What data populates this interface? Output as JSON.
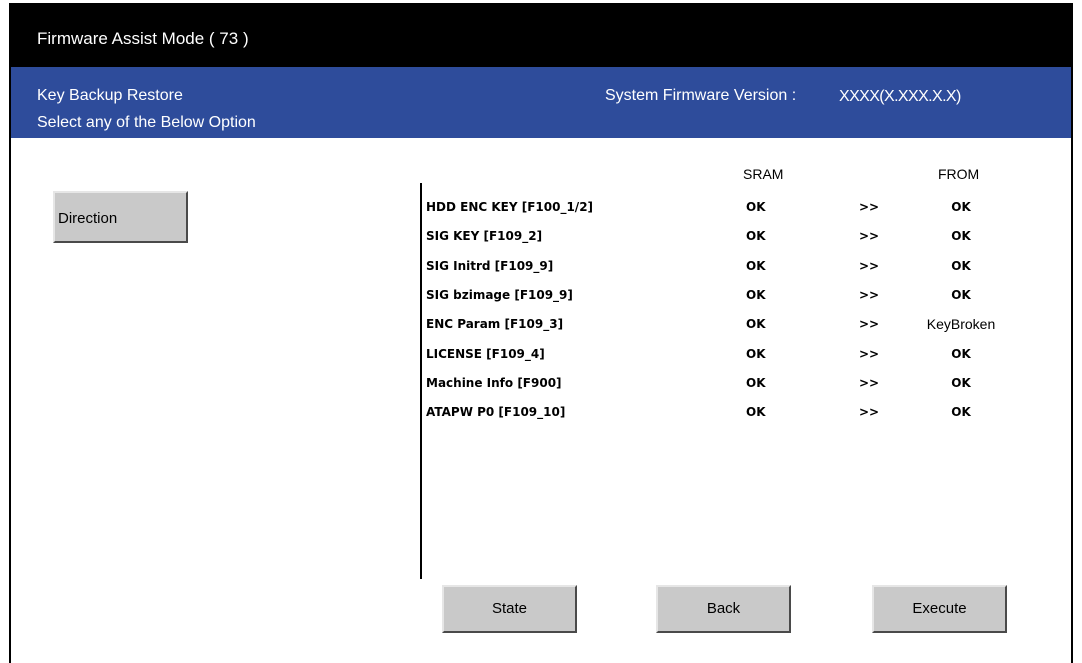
{
  "window": {
    "title": "Firmware Assist Mode ( 73 )"
  },
  "subheader": {
    "line1": "Key Backup Restore",
    "line2": "Select any of the Below Option",
    "version_label": "System Firmware Version :",
    "version_value": "XXXX(X.XXX.X.X)"
  },
  "left_panel": {
    "direction_button": "Direction"
  },
  "table": {
    "headers": {
      "sram": "SRAM",
      "from": "FROM"
    },
    "rows": [
      {
        "name": "HDD ENC KEY [F100_1/2]",
        "sram": "OK",
        "arrow": ">>",
        "from": "OK"
      },
      {
        "name": "SIG KEY [F109_2]",
        "sram": "OK",
        "arrow": ">>",
        "from": "OK"
      },
      {
        "name": "SIG Initrd [F109_9]",
        "sram": "OK",
        "arrow": ">>",
        "from": "OK"
      },
      {
        "name": "SIG bzimage [F109_9]",
        "sram": "OK",
        "arrow": ">>",
        "from": "OK"
      },
      {
        "name": "ENC Param [F109_3]",
        "sram": "OK",
        "arrow": ">>",
        "from": "KeyBroken"
      },
      {
        "name": "LICENSE [F109_4]",
        "sram": "OK",
        "arrow": ">>",
        "from": "OK"
      },
      {
        "name": "Machine Info [F900]",
        "sram": "OK",
        "arrow": ">>",
        "from": "OK"
      },
      {
        "name": "ATAPW P0 [F109_10]",
        "sram": "OK",
        "arrow": ">>",
        "from": "OK"
      }
    ]
  },
  "buttons": {
    "state": "State",
    "back": "Back",
    "execute": "Execute"
  },
  "colors": {
    "titlebar": "#000000",
    "subbar": "#2e4c9b",
    "button": "#c9c9c9"
  }
}
